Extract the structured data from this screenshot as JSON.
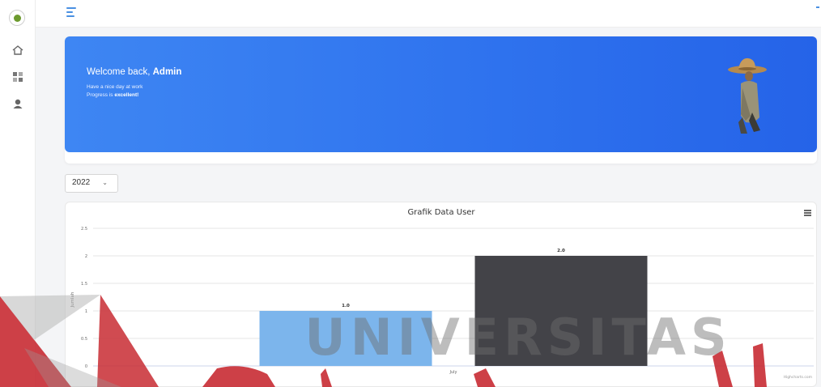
{
  "sidebar": {
    "items": [
      {
        "icon": "home-icon"
      },
      {
        "icon": "dashboard-grid-icon"
      },
      {
        "icon": "user-icon"
      }
    ]
  },
  "welcome": {
    "greeting": "Welcome back, ",
    "name": "Admin",
    "line1": "Have a nice day at work",
    "line2_prefix": "Progress is ",
    "line2_bold": "excellent!"
  },
  "year_select": {
    "value": "2022"
  },
  "chart": {
    "credit": "Highcharts.com"
  },
  "chart_data": {
    "type": "bar",
    "title": "Grafik Data User",
    "ylabel": "Jumlah",
    "xlabel": "",
    "categories": [
      "July"
    ],
    "series": [
      {
        "values": [
          1.0
        ],
        "color": "#7cb5ec"
      },
      {
        "values": [
          2.0
        ],
        "color": "#434348"
      }
    ],
    "ylim": [
      0,
      2.5
    ],
    "yticks": [
      "0",
      "0.5",
      "1",
      "1.5",
      "2",
      "2.5"
    ],
    "data_labels": [
      "1.0",
      "2.0"
    ],
    "grid": true,
    "legend": "none"
  },
  "watermark": {
    "text": "UNIVERSITAS"
  },
  "colors": {
    "accent": "#2f73ee",
    "bar1": "#7cb5ec",
    "bar2": "#434348",
    "watermark": "#c82b33"
  }
}
